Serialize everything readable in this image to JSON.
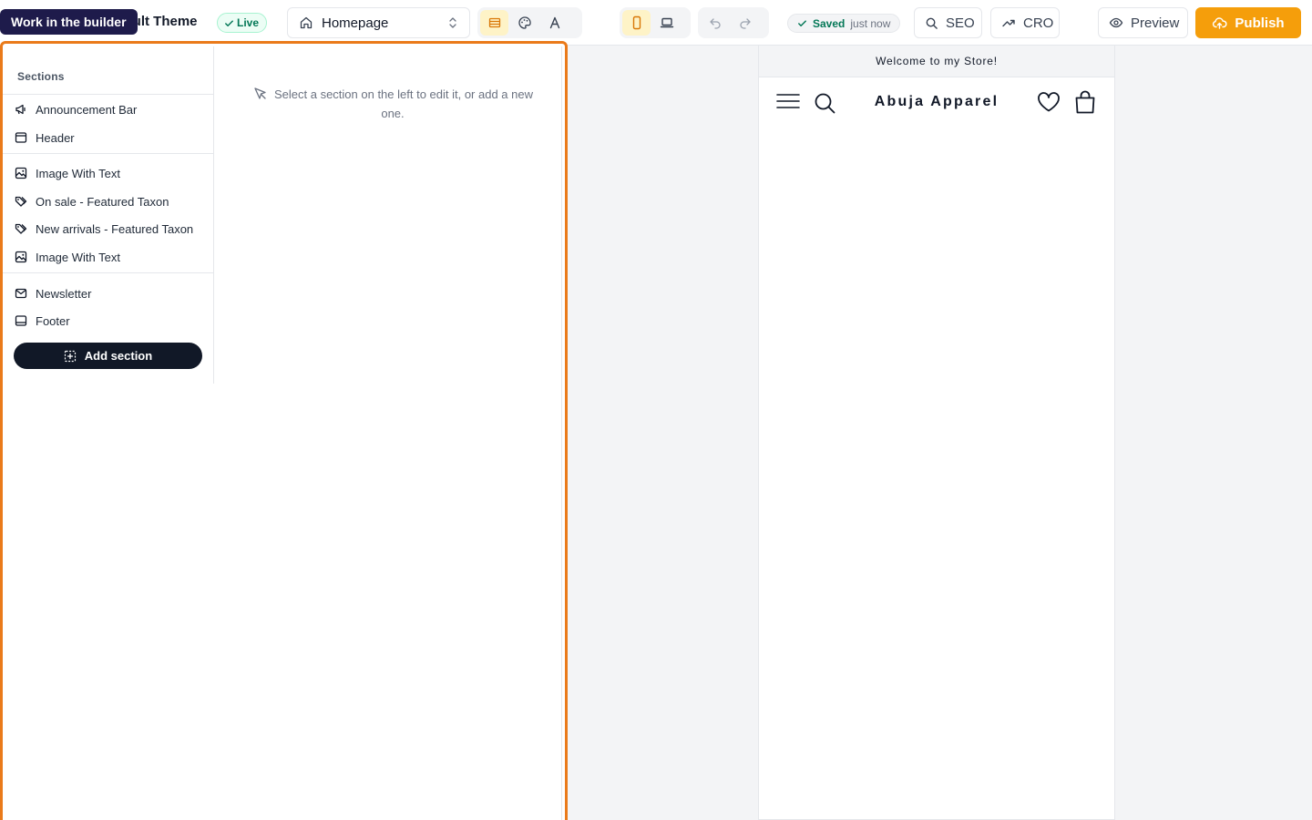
{
  "topbar": {
    "tooltip": "Work in the builder",
    "theme_name": "efault Theme",
    "live_badge": "Live",
    "page_select": "Homepage",
    "saved_label": "Saved",
    "saved_time": "just now",
    "seo_label": "SEO",
    "cro_label": "CRO",
    "preview_label": "Preview",
    "publish_label": "Publish",
    "accent_color": "#f59e0b",
    "icons": [
      "home-icon",
      "chevron-up-down-icon",
      "layout-icon",
      "palette-icon",
      "typography-icon",
      "mobile-icon",
      "desktop-icon",
      "undo-icon",
      "redo-icon",
      "check-icon",
      "search-icon",
      "trending-up-icon",
      "eye-icon",
      "cloud-upload-icon"
    ]
  },
  "sections": {
    "title": "Sections",
    "items": [
      {
        "label": "Announcement Bar",
        "icon": "megaphone-icon"
      },
      {
        "label": "Header",
        "icon": "header-layout-icon"
      },
      {
        "label": "Image With Text",
        "icon": "image-icon"
      },
      {
        "label": "On sale - Featured Taxon",
        "icon": "tags-icon"
      },
      {
        "label": "New arrivals - Featured Taxon",
        "icon": "tags-icon"
      },
      {
        "label": "Image With Text",
        "icon": "image-icon"
      },
      {
        "label": "Newsletter",
        "icon": "mail-icon"
      },
      {
        "label": "Footer",
        "icon": "footer-layout-icon"
      }
    ],
    "add_label": "Add section"
  },
  "editor": {
    "hint": "Select a section on the left to edit it, or add a new one."
  },
  "preview": {
    "announcement": "Welcome to my Store!",
    "brand": "Abuja Apparel"
  }
}
